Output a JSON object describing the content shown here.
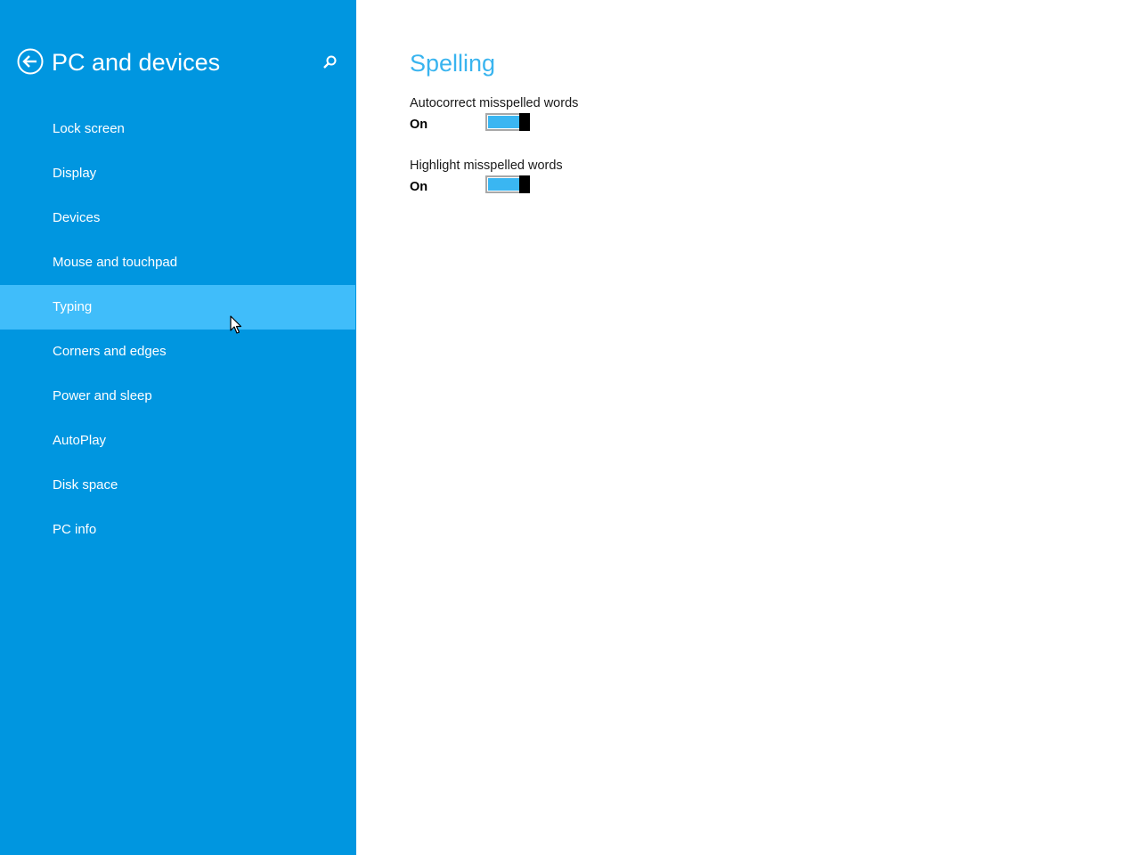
{
  "sidebar": {
    "title": "PC and devices",
    "items": [
      {
        "label": "Lock screen"
      },
      {
        "label": "Display"
      },
      {
        "label": "Devices"
      },
      {
        "label": "Mouse and touchpad"
      },
      {
        "label": "Typing",
        "selected": true
      },
      {
        "label": "Corners and edges"
      },
      {
        "label": "Power and sleep"
      },
      {
        "label": "AutoPlay"
      },
      {
        "label": "Disk space"
      },
      {
        "label": "PC info"
      }
    ]
  },
  "main": {
    "section_title": "Spelling",
    "settings": [
      {
        "label": "Autocorrect misspelled words",
        "state": "On",
        "enabled": true
      },
      {
        "label": "Highlight misspelled words",
        "state": "On",
        "enabled": true
      }
    ]
  },
  "icons": {
    "back": "back-arrow-circle-icon",
    "search": "search-icon",
    "cursor": "mouse-pointer-icon"
  },
  "colors": {
    "sidebar_bg": "#0096e0",
    "selected_bg": "#40bdfa",
    "accent": "#39b4ef",
    "toggle_fill": "#3ab6f2"
  }
}
